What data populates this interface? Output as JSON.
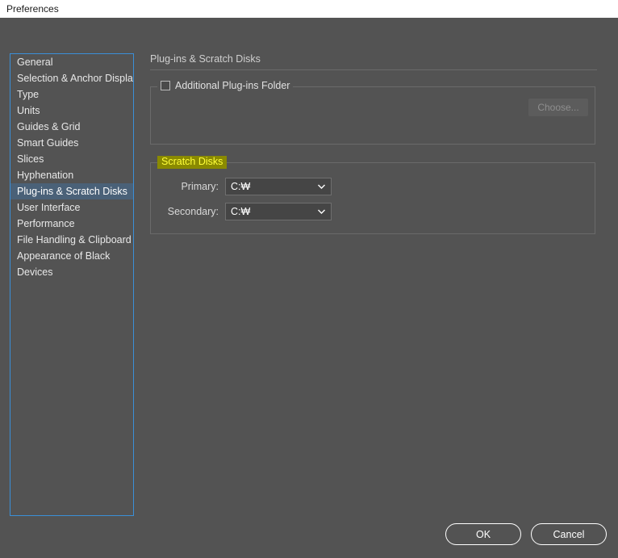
{
  "window": {
    "title": "Preferences"
  },
  "sidebar": {
    "items": [
      {
        "label": "General",
        "selected": false
      },
      {
        "label": "Selection & Anchor Display",
        "selected": false
      },
      {
        "label": "Type",
        "selected": false
      },
      {
        "label": "Units",
        "selected": false
      },
      {
        "label": "Guides & Grid",
        "selected": false
      },
      {
        "label": "Smart Guides",
        "selected": false
      },
      {
        "label": "Slices",
        "selected": false
      },
      {
        "label": "Hyphenation",
        "selected": false
      },
      {
        "label": "Plug-ins & Scratch Disks",
        "selected": true
      },
      {
        "label": "User Interface",
        "selected": false
      },
      {
        "label": "Performance",
        "selected": false
      },
      {
        "label": "File Handling & Clipboard",
        "selected": false
      },
      {
        "label": "Appearance of Black",
        "selected": false
      },
      {
        "label": "Devices",
        "selected": false
      }
    ]
  },
  "content": {
    "header": "Plug-ins & Scratch Disks",
    "plugins_group": {
      "checkbox_label": "Additional Plug-ins Folder",
      "checked": false,
      "choose_label": "Choose...",
      "choose_disabled": true
    },
    "scratch_group": {
      "legend": "Scratch Disks",
      "legend_highlight_bg": "#8a8a00",
      "legend_highlight_fg": "#ffff3a",
      "fields": [
        {
          "label": "Primary:",
          "value": "C:₩"
        },
        {
          "label": "Secondary:",
          "value": "C:₩"
        }
      ]
    }
  },
  "footer": {
    "ok_label": "OK",
    "cancel_label": "Cancel"
  },
  "colors": {
    "dialog_bg": "#535353",
    "selection": "#4a6178",
    "focus_border": "#3a8fd8"
  }
}
